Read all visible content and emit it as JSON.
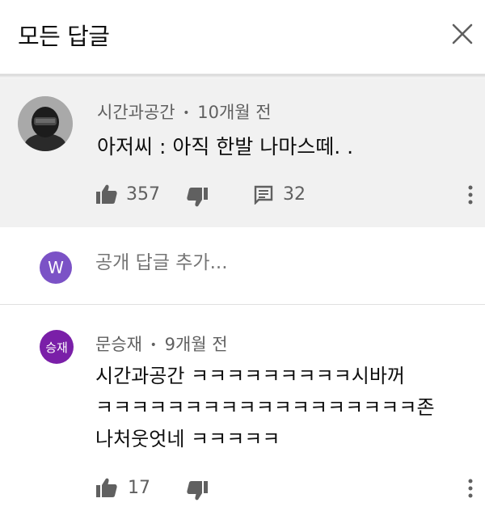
{
  "header": {
    "title": "모든 답글",
    "close_icon": "close-icon"
  },
  "parent_comment": {
    "author": "시간과공간",
    "separator": "•",
    "time": "10개월 전",
    "text": "아저씨 : 아직 한발 나마스떼. .",
    "likes": "357",
    "replies": "32"
  },
  "reply_box": {
    "avatar_letter": "W",
    "placeholder": "공개 답글 추가..."
  },
  "reply": {
    "avatar_text": "승재",
    "author": "문승재",
    "separator": "•",
    "time": "9개월 전",
    "lines": [
      "시간과공간 ㅋㅋㅋㅋㅋㅋㅋㅋㅋ시바꺼",
      "ㅋㅋㅋㅋㅋㅋㅋㅋㅋㅋㅋㅋㅋㅋㅋㅋㅋㅋ존",
      "나처웃엇네 ㅋㅋㅋㅋㅋ"
    ],
    "likes": "17"
  },
  "colors": {
    "background": "#ffffff",
    "highlight": "#f1f1f1",
    "avatar_w": "#7b52c6",
    "avatar_s": "#7a1fa8",
    "icon": "#606060"
  }
}
